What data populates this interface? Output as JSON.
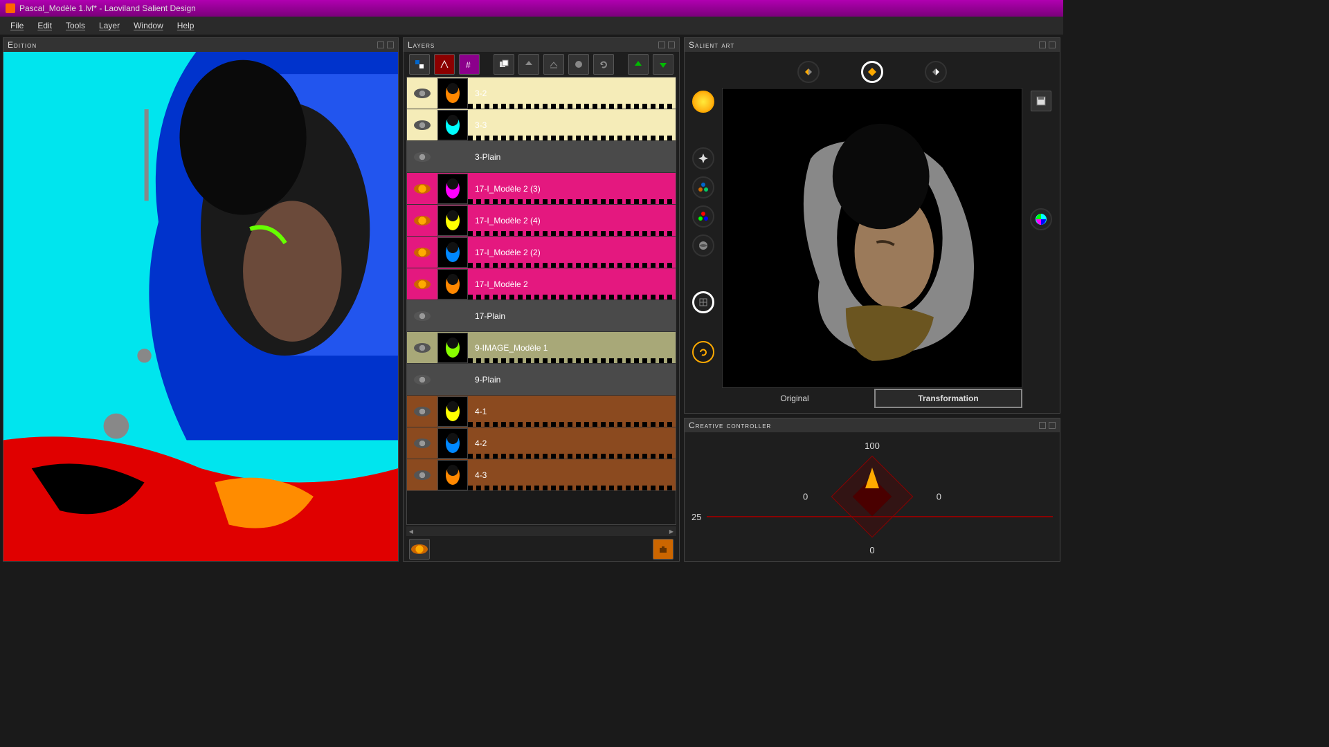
{
  "title": "Pascal_Modèle 1.lvf* - Laoviland Salient Design",
  "menu": {
    "file": "File",
    "edit": "Edit",
    "tools": "Tools",
    "layer": "Layer",
    "window": "Window",
    "help": "Help"
  },
  "panels": {
    "edition": "Edition",
    "layers": "Layers",
    "salient": "Salient art",
    "controller": "Creative controller"
  },
  "layers": [
    {
      "name": "3-2",
      "color": "c-cream",
      "film": true,
      "thumb": true
    },
    {
      "name": "3-3",
      "color": "c-cream",
      "film": true,
      "thumb": true
    },
    {
      "name": "3-Plain",
      "color": "c-gray",
      "film": false,
      "thumb": false
    },
    {
      "name": "17-I_Modèle 2 (3)",
      "color": "c-pink",
      "film": true,
      "thumb": true,
      "eye": "orange"
    },
    {
      "name": "17-I_Modèle 2 (4)",
      "color": "c-pink",
      "film": true,
      "thumb": true,
      "eye": "orange"
    },
    {
      "name": "17-I_Modèle 2 (2)",
      "color": "c-pink",
      "film": true,
      "thumb": true,
      "eye": "orange"
    },
    {
      "name": "17-I_Modèle 2",
      "color": "c-pink",
      "film": true,
      "thumb": true,
      "eye": "orange"
    },
    {
      "name": "17-Plain",
      "color": "c-gray",
      "film": false,
      "thumb": false
    },
    {
      "name": "9-IMAGE_Modèle 1",
      "color": "c-olive",
      "film": true,
      "thumb": true
    },
    {
      "name": "9-Plain",
      "color": "c-gray",
      "film": false,
      "thumb": false
    },
    {
      "name": "4-1",
      "color": "c-brown",
      "film": true,
      "thumb": true
    },
    {
      "name": "4-2",
      "color": "c-brown",
      "film": true,
      "thumb": true
    },
    {
      "name": "4-3",
      "color": "c-brown",
      "film": true,
      "thumb": true
    }
  ],
  "salient_tabs": {
    "original": "Original",
    "transformation": "Transformation",
    "active": "transformation"
  },
  "controller_values": {
    "top": "100",
    "left": "0",
    "right": "0",
    "bottom": "0",
    "slider": "25"
  },
  "colors": {
    "accent": "#e4187f",
    "titlebar": "#8b008b",
    "cyan": "#00e5ee"
  }
}
